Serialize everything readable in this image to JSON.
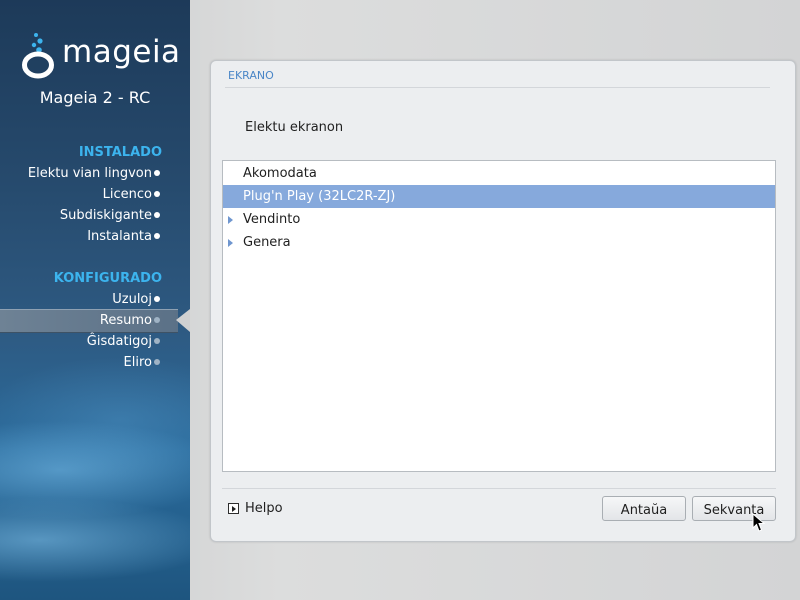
{
  "sidebar": {
    "brand": "mageia",
    "version": "Mageia 2 - RC",
    "sections": [
      {
        "title": "INSTALADO",
        "steps": [
          {
            "label": "Elektu vian lingvon",
            "state": "done"
          },
          {
            "label": "Licenco",
            "state": "done"
          },
          {
            "label": "Subdiskigante",
            "state": "done"
          },
          {
            "label": "Instalanta",
            "state": "done"
          }
        ]
      },
      {
        "title": "KONFIGURADO",
        "steps": [
          {
            "label": "Uzuloj",
            "state": "done"
          },
          {
            "label": "Resumo",
            "state": "active"
          },
          {
            "label": "Ĝisdatigoj",
            "state": "pending"
          },
          {
            "label": "Eliro",
            "state": "pending"
          }
        ]
      }
    ]
  },
  "panel": {
    "title": "EKRANO",
    "prompt": "Elektu ekranon",
    "tree": [
      {
        "label": "Akomodata",
        "expandable": false,
        "selected": false
      },
      {
        "label": "Plug'n Play (32LC2R-ZJ)",
        "expandable": false,
        "selected": true
      },
      {
        "label": "Vendinto",
        "expandable": true,
        "selected": false
      },
      {
        "label": "Genera",
        "expandable": true,
        "selected": false
      }
    ],
    "help_label": "Helpo",
    "back_label": "Antaŭa",
    "next_label": "Sekvanta"
  },
  "colors": {
    "accent": "#3cb4ee",
    "selection": "#86a9dc",
    "panel_title": "#4a86c7"
  },
  "icons": {
    "logo": "mageia-logo-icon",
    "expander": "triangle-right-icon",
    "help": "help-toggle-icon",
    "cursor": "mouse-pointer-icon"
  }
}
